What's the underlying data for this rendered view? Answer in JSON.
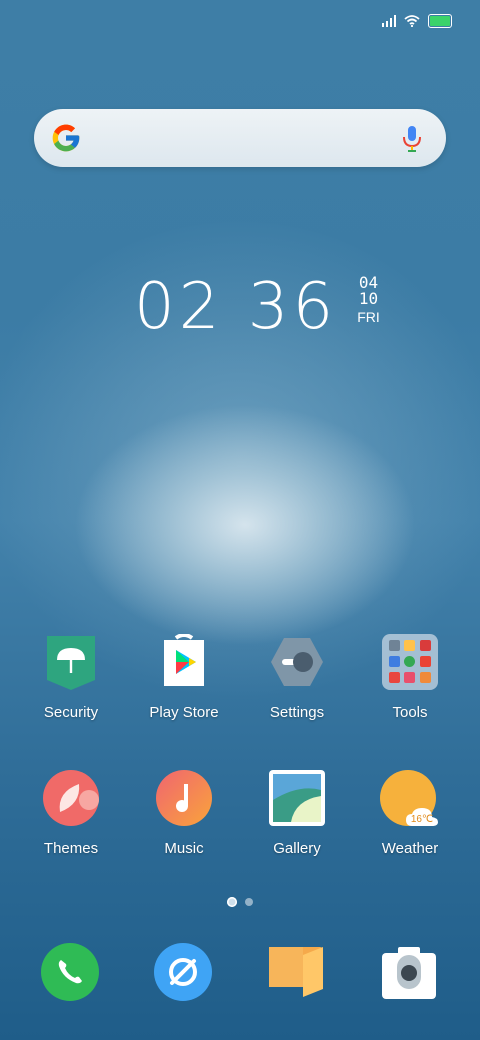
{
  "status_bar": {
    "battery_color": "#3bd36a"
  },
  "search": {
    "logo": "google-g-icon",
    "voice": "mic-icon"
  },
  "clock": {
    "time": "02 36",
    "month": "04",
    "day": "10",
    "weekday": "FRI"
  },
  "home_row1": [
    {
      "label": "Security",
      "icon": "umbrella-shield-icon",
      "color": "#2ea57f"
    },
    {
      "label": "Play Store",
      "icon": "play-store-icon",
      "color": "#ffffff"
    },
    {
      "label": "Settings",
      "icon": "settings-hexagon-icon",
      "color": "#7f96a8"
    },
    {
      "label": "Tools",
      "icon": "folder-icon",
      "color": "#9fb3c4"
    }
  ],
  "home_row2": [
    {
      "label": "Themes",
      "icon": "themes-icon",
      "color": "#f06a68"
    },
    {
      "label": "Music",
      "icon": "music-note-icon",
      "color": "#f7873f"
    },
    {
      "label": "Gallery",
      "icon": "gallery-icon",
      "color": "#3a9c86"
    },
    {
      "label": "Weather",
      "icon": "weather-sun-icon",
      "color": "#f6b13c",
      "temp": "16℃"
    }
  ],
  "page_indicator": {
    "pages": 2,
    "current": 1
  },
  "dock": [
    {
      "name": "phone",
      "icon": "phone-icon",
      "color": "#2fbb55"
    },
    {
      "name": "browser",
      "icon": "compass-icon",
      "color": "#3fa4f5"
    },
    {
      "name": "notes",
      "icon": "notes-icon",
      "color": "#f5a94b"
    },
    {
      "name": "camera",
      "icon": "camera-icon",
      "color": "#ffffff"
    }
  ]
}
